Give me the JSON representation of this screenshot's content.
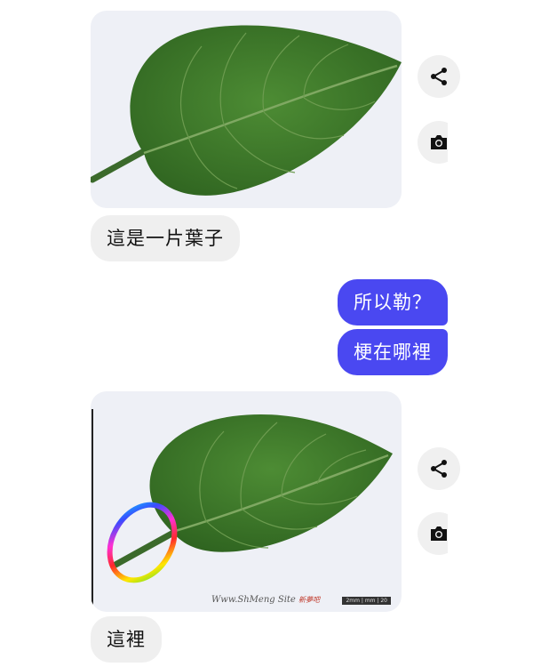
{
  "messages": {
    "first_caption": "這是一片葉子",
    "reply_1": "所以勒？",
    "reply_2": "梗在哪裡",
    "last_caption": "這裡"
  },
  "watermark": {
    "text": "Www.ShMeng Site",
    "sub": "新夢吧"
  },
  "scalebar": {
    "text": "2mm | mm | 20"
  },
  "icons": {
    "share": "share-icon",
    "camera": "camera-icon"
  },
  "colors": {
    "outgoing_bubble": "#4a48f1",
    "incoming_bubble": "#efefef",
    "leaf": "#3f7b2c"
  }
}
